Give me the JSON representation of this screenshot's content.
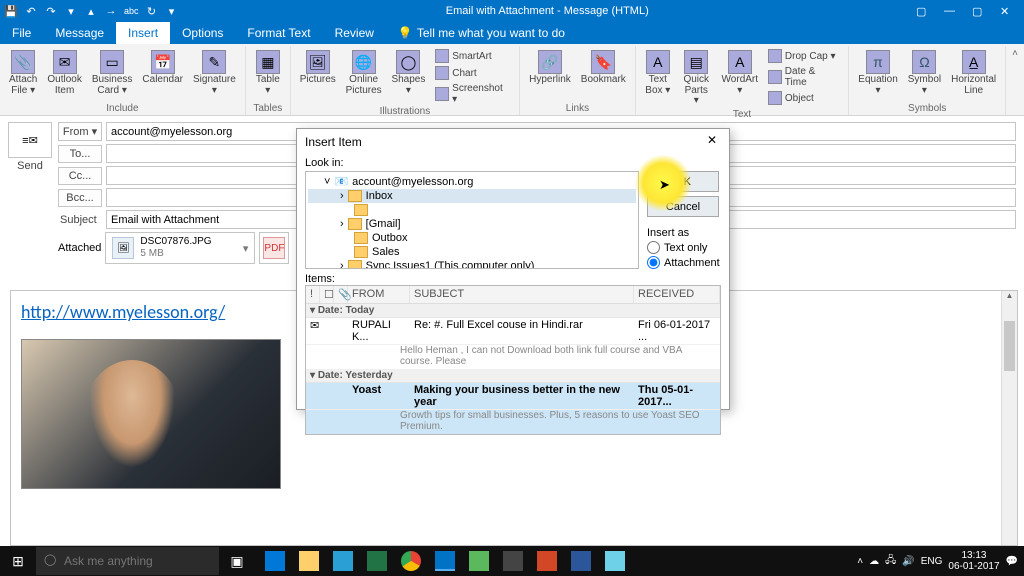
{
  "window": {
    "title": "Email with Attachment  -  Message (HTML)"
  },
  "qat": {
    "abc": "abc"
  },
  "menutabs": {
    "file": "File",
    "message": "Message",
    "insert": "Insert",
    "options": "Options",
    "format": "Format Text",
    "review": "Review",
    "tellme": "Tell me what you want to do"
  },
  "ribbon": {
    "include": {
      "group": "Include",
      "attachfile": "Attach\nFile ▾",
      "outlookitem": "Outlook\nItem",
      "businesscard": "Business\nCard ▾",
      "calendar": "Calendar",
      "signature": "Signature\n▾"
    },
    "tables": {
      "group": "Tables",
      "table": "Table\n▾"
    },
    "illustrations": {
      "group": "Illustrations",
      "pictures": "Pictures",
      "online": "Online\nPictures",
      "shapes": "Shapes\n▾",
      "smartart": "SmartArt",
      "chart": "Chart",
      "screenshot": "Screenshot ▾"
    },
    "links": {
      "group": "Links",
      "hyperlink": "Hyperlink",
      "bookmark": "Bookmark"
    },
    "text": {
      "group": "Text",
      "textbox": "Text\nBox ▾",
      "quickparts": "Quick\nParts ▾",
      "wordart": "WordArt\n▾",
      "dropcap": "Drop Cap ▾",
      "datetime": "Date & Time",
      "object": "Object"
    },
    "symbols": {
      "group": "Symbols",
      "equation": "Equation\n▾",
      "symbol": "Symbol\n▾",
      "hline": "Horizontal\nLine"
    }
  },
  "compose": {
    "send": "Send",
    "fromlbl": "From ▾",
    "from": "account@myelesson.org",
    "to": "To...",
    "tov": "",
    "cc": "Cc...",
    "ccv": "",
    "bcc": "Bcc...",
    "bccv": "",
    "subjectlbl": "Subject",
    "subject": "Email with Attachment",
    "attachedlbl": "Attached",
    "att1": {
      "name": "DSC07876.JPG",
      "size": "5 MB"
    },
    "att2": {
      "name": "",
      "size": ""
    }
  },
  "body": {
    "link": "http://www.myelesson.org/"
  },
  "dialog": {
    "title": "Insert Item",
    "lookin": "Look in:",
    "tree": {
      "root": "account@myelesson.org",
      "inbox": "Inbox",
      "gmail": "[Gmail]",
      "outbox": "Outbox",
      "sales": "Sales",
      "sync": "Sync Issues1 (This computer only)"
    },
    "ok": "OK",
    "cancel": "Cancel",
    "insertas": "Insert as",
    "textonly": "Text only",
    "attachment": "Attachment",
    "itemslbl": "Items:",
    "cols": {
      "from": "FROM",
      "subject": "SUBJECT",
      "received": "RECEIVED"
    },
    "grp1": "Date: Today",
    "msg1": {
      "from": "RUPALI K...",
      "subj": "Re: #. Full Excel couse in Hindi.rar",
      "recv": "Fri 06-01-2017 ...",
      "prev": "Hello Heman ,  I can not Download both link full course and VBA course.  Please"
    },
    "grp2": "Date: Yesterday",
    "msg2": {
      "from": "Yoast",
      "subj": "Making your business better in the new year",
      "recv": "Thu 05-01-2017...",
      "prev": "Growth tips for small businesses. Plus, 5 reasons to use Yoast SEO Premium."
    }
  },
  "taskbar": {
    "search": "Ask me anything",
    "lang": "ENG",
    "time": "13:13",
    "date": "06-01-2017"
  }
}
